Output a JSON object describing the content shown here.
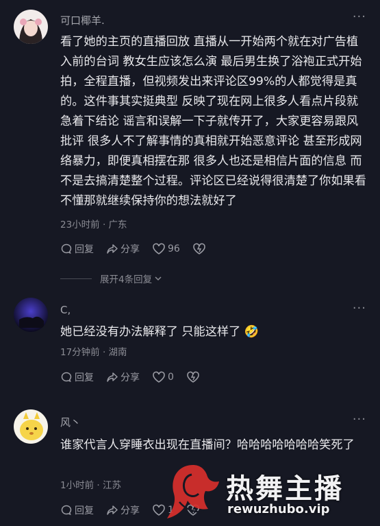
{
  "comments": [
    {
      "username": "可口椰羊.",
      "text": "看了她的主页的直播回放 直播从一开始两个就在对广告植入前的台词 教女生应该怎么演 最后男生换了浴袍正式开始拍，全程直播，但视频发出来评论区99%的人都觉得是真的。这件事其实挺典型 反映了现在网上很多人看点片段就急着下结论 谣言和误解一下子就传开了，大家更容易跟风批评 很多人不了解事情的真相就开始恶意评论 甚至形成网络暴力，即便真相摆在那 很多人也还是相信片面的信息 而不是去搞清楚整个过程。评论区已经说得很清楚了你如果看不懂那就继续保持你的想法就好了",
      "meta": "23小时前 · 广东",
      "reply": "回复",
      "share": "分享",
      "likes": "96"
    },
    {
      "username": "C,",
      "text": "她已经没有办法解释了 只能这样了 🤣",
      "meta": "17分钟前 · 湖南",
      "reply": "回复",
      "share": "分享",
      "likes": "0"
    },
    {
      "username": "风丶",
      "text": "谁家代言人穿睡衣出现在直播间？哈哈哈哈哈哈哈笑死了",
      "meta": "1小时前 · 江苏",
      "reply": "回复",
      "share": "分享",
      "likes": "1"
    }
  ],
  "expand_replies": "展开4条回复",
  "watermark": {
    "title": "热舞主播",
    "url": "rewuzhubo.vip"
  },
  "colors": {
    "background": "#161823",
    "text": "#e8e8eb",
    "muted": "#8b8c94",
    "watermark_logo": "#d8302c"
  }
}
